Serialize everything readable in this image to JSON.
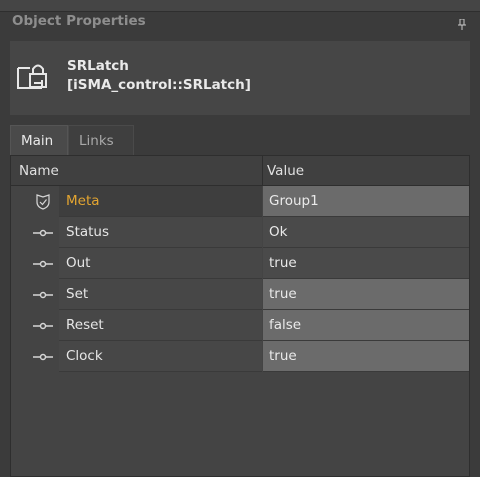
{
  "panel": {
    "title": "Object Properties",
    "pin_icon": "pin-icon"
  },
  "object": {
    "name": "SRLatch",
    "type": "[iSMA_control::SRLatch]",
    "icon": "locked-component-icon"
  },
  "tabs": [
    {
      "label": "Main",
      "active": true
    },
    {
      "label": "Links",
      "active": false
    }
  ],
  "grid": {
    "columns": {
      "name": "Name",
      "value": "Value"
    },
    "rows": [
      {
        "label": "Meta",
        "value": "Group1",
        "icon": "shield-check-icon"
      },
      {
        "label": "Status",
        "value": "Ok",
        "icon": "slot-link-icon"
      },
      {
        "label": "Out",
        "value": "true",
        "icon": "slot-link-icon"
      },
      {
        "label": "Set",
        "value": "true",
        "icon": "slot-link-icon"
      },
      {
        "label": "Reset",
        "value": "false",
        "icon": "slot-link-icon"
      },
      {
        "label": "Clock",
        "value": "true",
        "icon": "slot-link-icon"
      }
    ]
  },
  "colors": {
    "meta_label": "#e3a531",
    "editable_value_bg": "#6b6b6b",
    "panel_bg": "#3b3b3b"
  }
}
